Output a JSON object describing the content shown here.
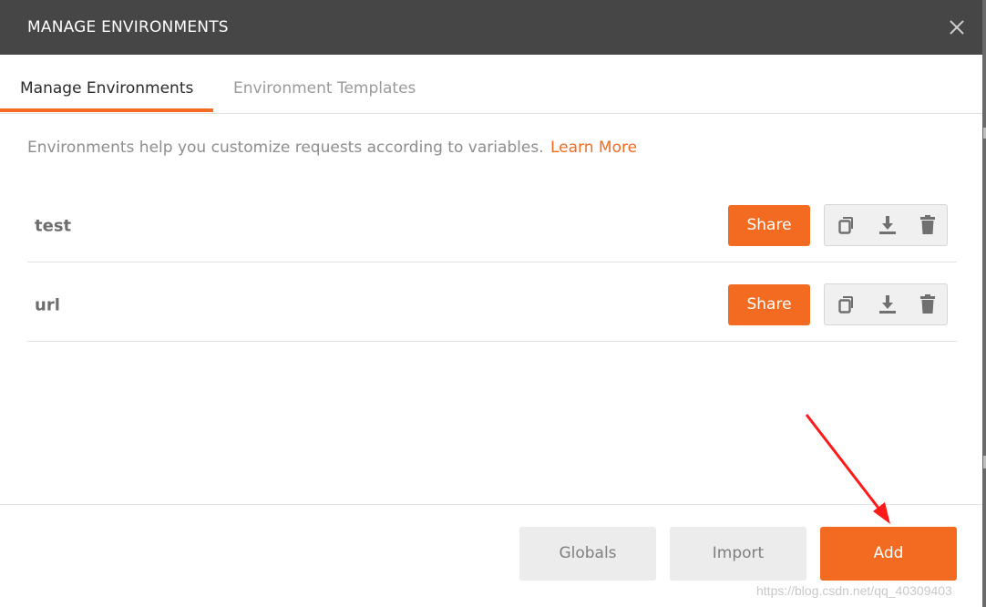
{
  "dialog": {
    "title": "MANAGE ENVIRONMENTS",
    "close_icon": "close-icon"
  },
  "tabs": [
    {
      "label": "Manage Environments",
      "active": true
    },
    {
      "label": "Environment Templates",
      "active": false
    }
  ],
  "info": {
    "text": "Environments help you customize requests according to variables.",
    "link": "Learn More"
  },
  "environments": [
    {
      "name": "test",
      "share_label": "Share",
      "icons": [
        "duplicate-icon",
        "download-icon",
        "trash-icon"
      ]
    },
    {
      "name": "url",
      "share_label": "Share",
      "icons": [
        "duplicate-icon",
        "download-icon",
        "trash-icon"
      ]
    }
  ],
  "footer": {
    "globals_label": "Globals",
    "import_label": "Import",
    "add_label": "Add"
  },
  "watermark": "https://blog.csdn.net/qq_40309403",
  "colors": {
    "accent": "#f26b21",
    "header": "#464646",
    "annotation_arrow": "#ff1a1a"
  }
}
